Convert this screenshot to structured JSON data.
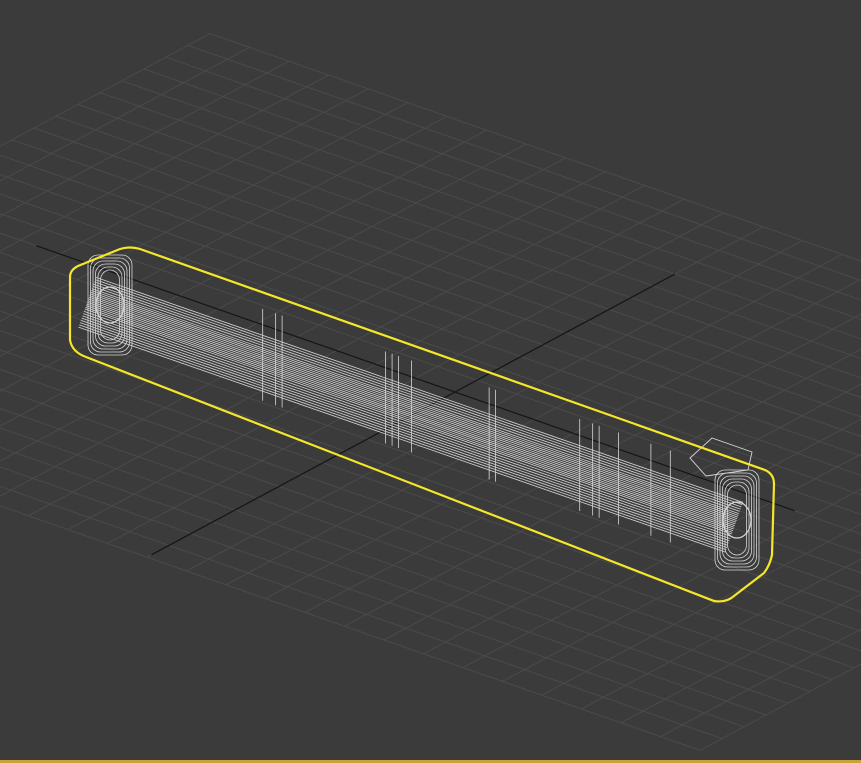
{
  "viewport": {
    "background_color": "#3b3b3b",
    "grid_color": "#4a4a4a",
    "grid_axis_color": "#141414",
    "wireframe_color": "#d6d6d6",
    "selection_color": "#f5e62a",
    "active_border_color": "#c9a23a"
  },
  "scene": {
    "object_type": "box-like wireframe mesh (elongated bar)",
    "selected": true
  }
}
